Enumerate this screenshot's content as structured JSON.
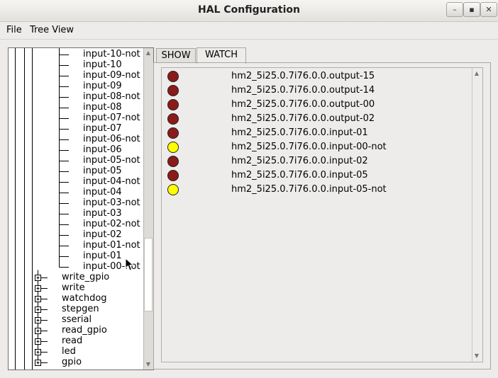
{
  "window": {
    "title": "HAL Configuration",
    "buttons": [
      "–",
      "▪",
      "✕"
    ]
  },
  "menu": [
    "File",
    "Tree View"
  ],
  "tree": {
    "items": [
      {
        "label": "input-10-not",
        "level": 1
      },
      {
        "label": "input-10",
        "level": 1
      },
      {
        "label": "input-09-not",
        "level": 1
      },
      {
        "label": "input-09",
        "level": 1
      },
      {
        "label": "input-08-not",
        "level": 1
      },
      {
        "label": "input-08",
        "level": 1
      },
      {
        "label": "input-07-not",
        "level": 1
      },
      {
        "label": "input-07",
        "level": 1
      },
      {
        "label": "input-06-not",
        "level": 1
      },
      {
        "label": "input-06",
        "level": 1
      },
      {
        "label": "input-05-not",
        "level": 1
      },
      {
        "label": "input-05",
        "level": 1
      },
      {
        "label": "input-04-not",
        "level": 1
      },
      {
        "label": "input-04",
        "level": 1
      },
      {
        "label": "input-03-not",
        "level": 1
      },
      {
        "label": "input-03",
        "level": 1
      },
      {
        "label": "input-02-not",
        "level": 1
      },
      {
        "label": "input-02",
        "level": 1
      },
      {
        "label": "input-01-not",
        "level": 1
      },
      {
        "label": "input-01",
        "level": 1
      },
      {
        "label": "input-00-not",
        "level": 1
      },
      {
        "label": "write_gpio",
        "level": 0
      },
      {
        "label": "write",
        "level": 0
      },
      {
        "label": "watchdog",
        "level": 0
      },
      {
        "label": "stepgen",
        "level": 0
      },
      {
        "label": "sserial",
        "level": 0
      },
      {
        "label": "read_gpio",
        "level": 0
      },
      {
        "label": "read",
        "level": 0
      },
      {
        "label": "led",
        "level": 0
      },
      {
        "label": "gpio",
        "level": 0
      }
    ]
  },
  "tabs": [
    {
      "label": "SHOW",
      "active": false
    },
    {
      "label": "WATCH",
      "active": true
    }
  ],
  "watch": {
    "colors": {
      "off": "#8b1a1a",
      "on": "#ffff00"
    },
    "items": [
      {
        "name": "hm2_5i25.0.7i76.0.0.output-15",
        "state": "off"
      },
      {
        "name": "hm2_5i25.0.7i76.0.0.output-14",
        "state": "off"
      },
      {
        "name": "hm2_5i25.0.7i76.0.0.output-00",
        "state": "off"
      },
      {
        "name": "hm2_5i25.0.7i76.0.0.output-02",
        "state": "off"
      },
      {
        "name": "hm2_5i25.0.7i76.0.0.input-01",
        "state": "off"
      },
      {
        "name": "hm2_5i25.0.7i76.0.0.input-00-not",
        "state": "on"
      },
      {
        "name": "hm2_5i25.0.7i76.0.0.input-02",
        "state": "off"
      },
      {
        "name": "hm2_5i25.0.7i76.0.0.input-05",
        "state": "off"
      },
      {
        "name": "hm2_5i25.0.7i76.0.0.input-05-not",
        "state": "on"
      }
    ]
  }
}
